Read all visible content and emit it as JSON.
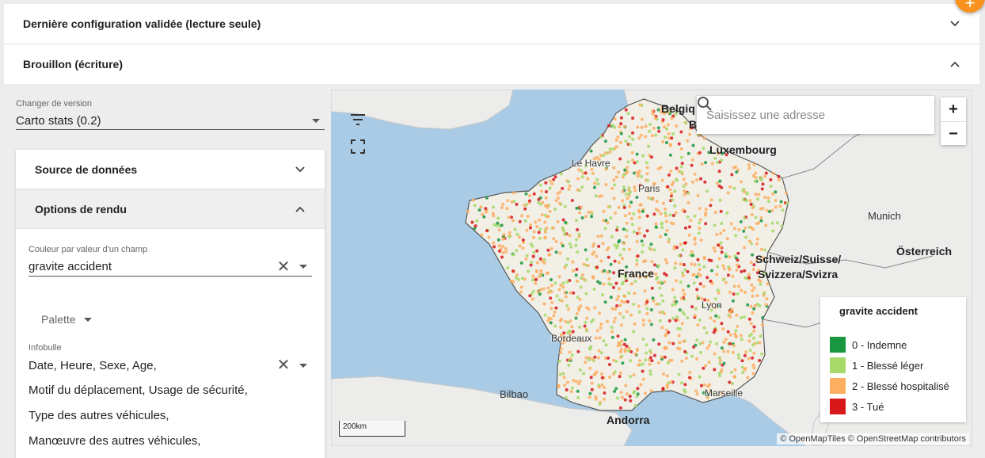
{
  "panels": {
    "last_config": {
      "title": "Dernière configuration validée (lecture seule)"
    },
    "draft": {
      "title": "Brouillon (écriture)"
    }
  },
  "fab": {
    "icon": "add-icon"
  },
  "version": {
    "label": "Changer de version",
    "value": "Carto stats (0.2)"
  },
  "sections": {
    "source": {
      "title": "Source de données"
    },
    "render": {
      "title": "Options de rendu"
    }
  },
  "color_field": {
    "label": "Couleur par valeur d'un champ",
    "value": "gravite accident"
  },
  "palette": {
    "label": "Palette"
  },
  "tooltip": {
    "label": "Infobulle",
    "lines": [
      "Date, Heure, Sexe, Age,",
      "Motif du déplacement, Usage de sécurité,",
      "Type des autres véhicules,",
      "Manœuvre des autres véhicules,"
    ]
  },
  "map": {
    "search_placeholder": "Saisissez une adresse",
    "zoom_in": "+",
    "zoom_out": "−",
    "labels": {
      "belgium": "Belgiq",
      "belgium2": "B",
      "luxembourg": "Luxembourg",
      "le_havre": "Le Havre",
      "paris": "Paris",
      "munich": "Munich",
      "swiss": "Schweiz/Suisse/",
      "swiss2": "Svizzera/Svizra",
      "austria": "Österreich",
      "france": "France",
      "lyon": "Lyon",
      "bordeaux": "Bordeaux",
      "bilbao": "Bilbao",
      "marseille": "Marseille",
      "andorra": "Andorra"
    },
    "scale": "200km",
    "attribution": "© OpenMapTiles © OpenStreetMap contributors",
    "legend": {
      "title": "gravite accident",
      "items": [
        {
          "label": "0 - Indemne",
          "color": "#1a9641"
        },
        {
          "label": "1 - Blessé léger",
          "color": "#a6d96a"
        },
        {
          "label": "2 - Blessé hospitalisé",
          "color": "#fdae61"
        },
        {
          "label": "3 - Tué",
          "color": "#d7191c"
        }
      ]
    },
    "colors": {
      "water": "#a9cbe5",
      "land": "#ececea",
      "france": "#f2efe6"
    }
  }
}
